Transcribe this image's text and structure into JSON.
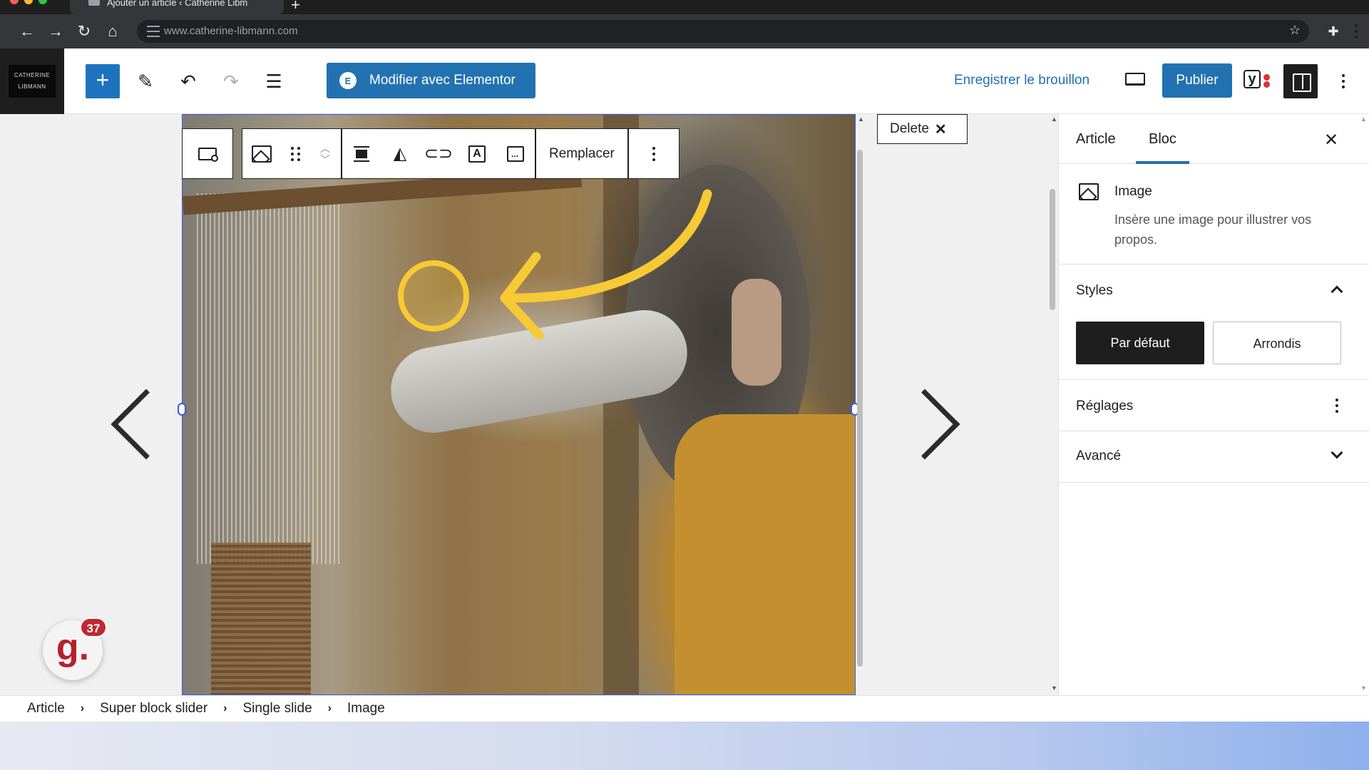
{
  "browser": {
    "tab_title": "Ajouter un article ‹ Catherine Libm",
    "new_tab_label": "+",
    "url": "www.catherine-libmann.com",
    "back_icon": "arrow-left-icon",
    "forward_icon": "arrow-right-icon",
    "reload_icon": "reload-icon",
    "home_icon": "home-icon",
    "bookmark_icon": "star-icon",
    "extensions_icon": "puzzle-icon"
  },
  "header": {
    "site_logo_line1": "CATHERINE",
    "site_logo_line2": "LIBMANN",
    "elementor_label": "Modifier avec Elementor",
    "elementor_logo": "E",
    "save_draft_label": "Enregistrer le brouillon",
    "publish_label": "Publier",
    "yoast_label": "y",
    "accent_color": "#2271b1"
  },
  "block_toolbar": {
    "replace_label": "Remplacer"
  },
  "canvas": {
    "delete_label": "Delete",
    "delete_icon": "close-icon"
  },
  "annotation": {
    "color": "#f6c935"
  },
  "sidebar": {
    "tabs": [
      {
        "label": "Article",
        "active": false
      },
      {
        "label": "Bloc",
        "active": true
      }
    ],
    "block_title": "Image",
    "block_description": "Insère une image pour illustrer vos propos.",
    "styles_title": "Styles",
    "style_options": [
      {
        "label": "Par défaut",
        "selected": true
      },
      {
        "label": "Arrondis",
        "selected": false
      }
    ],
    "settings_title": "Réglages",
    "advanced_title": "Avancé"
  },
  "breadcrumb": [
    "Article",
    "Super block slider",
    "Single slide",
    "Image"
  ],
  "breadcrumb_separator": "›",
  "badge": {
    "letter": "g.",
    "count": "37"
  }
}
